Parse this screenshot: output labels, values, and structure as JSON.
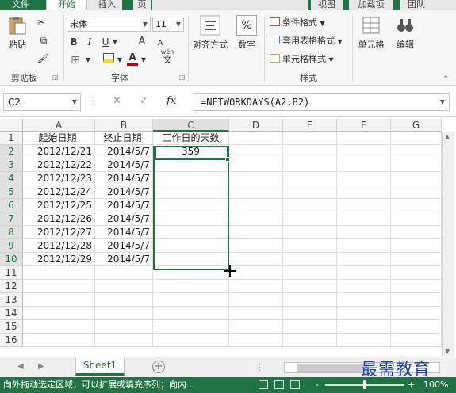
{
  "tabs": {
    "file": "文件",
    "home": "开始",
    "insert": "插入",
    "page": "页",
    "view": "视图",
    "addins": "加载项",
    "team": "团队"
  },
  "ribbon": {
    "clipboard": {
      "paste_label": "粘贴",
      "group_label": "剪贴板"
    },
    "font": {
      "font_name": "宋体",
      "font_size": "11",
      "bold": "B",
      "italic": "I",
      "underline": "U",
      "grow": "A",
      "shrink": "A",
      "font_color_glyph": "A",
      "phonetic": "wén",
      "phonetic_char": "文",
      "group_label": "字体"
    },
    "alignment": {
      "label": "对齐方式"
    },
    "number": {
      "label": "数字",
      "symbol": "%"
    },
    "styles": {
      "conditional": "条件格式",
      "table": "套用表格格式",
      "cell_styles": "单元格样式",
      "group_label": "样式"
    },
    "cells": {
      "label": "单元格"
    },
    "editing": {
      "label": "编辑"
    }
  },
  "formula_bar": {
    "name_box": "C2",
    "cancel": "✕",
    "enter": "✓",
    "fx": "fx",
    "formula": "=NETWORKDAYS(A2,B2)"
  },
  "grid": {
    "columns": [
      "A",
      "B",
      "C",
      "D",
      "E",
      "F",
      "G"
    ],
    "rows": [
      "1",
      "2",
      "3",
      "4",
      "5",
      "6",
      "7",
      "8",
      "9",
      "10",
      "11",
      "12",
      "13",
      "14",
      "15",
      "16"
    ],
    "headers": [
      "起始日期",
      "终止日期",
      "工作日的天数"
    ],
    "data": [
      [
        "2012/12/21",
        "2014/5/7",
        "359"
      ],
      [
        "2012/12/22",
        "2014/5/7",
        ""
      ],
      [
        "2012/12/23",
        "2014/5/7",
        ""
      ],
      [
        "2012/12/24",
        "2014/5/7",
        ""
      ],
      [
        "2012/12/25",
        "2014/5/7",
        ""
      ],
      [
        "2012/12/26",
        "2014/5/7",
        ""
      ],
      [
        "2012/12/27",
        "2014/5/7",
        ""
      ],
      [
        "2012/12/28",
        "2014/5/7",
        ""
      ],
      [
        "2012/12/29",
        "2014/5/7",
        ""
      ]
    ]
  },
  "sheets": {
    "active": "Sheet1",
    "add": "+"
  },
  "status": {
    "message": "向外拖动选定区域，可以扩展或填充序列；向内...",
    "zoom_minus": "-",
    "zoom_plus": "+",
    "zoom": "100%",
    "zoom_fraction": 1.0
  },
  "watermark": "最需教育",
  "colors": {
    "accent": "#217346",
    "watermark": "#1a3fb8",
    "font_color": "#c00000",
    "highlight": "#ffd700"
  }
}
